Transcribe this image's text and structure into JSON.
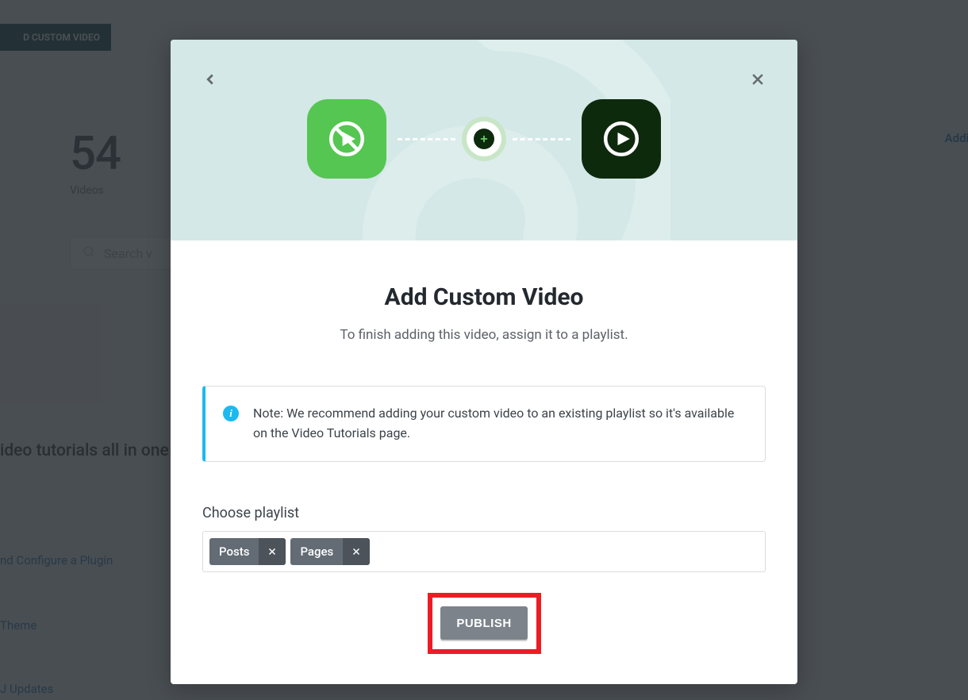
{
  "background": {
    "top_button": "D CUSTOM VIDEO",
    "count": "54",
    "count_label": "Videos",
    "search_placeholder": "Search v",
    "headline": "ideo tutorials all in one ha",
    "link_plugin": "nd Configure a Plugin",
    "link_theme": "Theme",
    "link_updates": "J Updates",
    "top_right_link": "Adding Imag"
  },
  "modal": {
    "title": "Add Custom Video",
    "subtitle": "To finish adding this video, assign it to a playlist.",
    "info_text": "Note: We recommend adding your custom video to an existing playlist so it's available on the Video Tutorials page.",
    "playlist_label": "Choose playlist",
    "tags": [
      {
        "label": "Posts"
      },
      {
        "label": "Pages"
      }
    ],
    "publish_label": "PUBLISH"
  }
}
